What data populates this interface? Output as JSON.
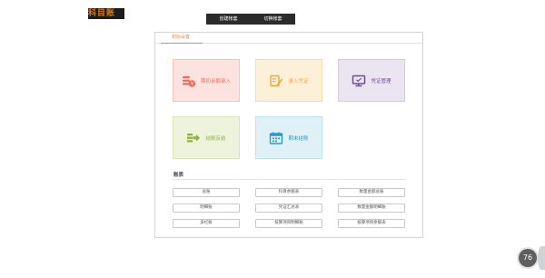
{
  "app": {
    "logo_text": "科目账"
  },
  "toolbar": {
    "buttons": [
      "创建帐套",
      "切换帐套"
    ]
  },
  "panel": {
    "tab_label": "初始设置",
    "tiles": [
      {
        "label": "期初余额录入",
        "icon": "coin-stack-icon",
        "bg": "#fde3df",
        "border": "#f5c4bd",
        "text": "#ea6c5a",
        "icon_color": "#ea6c5a"
      },
      {
        "label": "录入凭证",
        "icon": "edit-document-icon",
        "bg": "#fdf0d9",
        "border": "#f6dcae",
        "text": "#f0a73c",
        "icon_color": "#f0a73c"
      },
      {
        "label": "凭证管理",
        "icon": "monitor-icon",
        "bg": "#ebe4f1",
        "border": "#d6cae3",
        "text": "#6f4d93",
        "icon_color": "#6f4d93"
      },
      {
        "label": "结账反结",
        "icon": "transfer-icon",
        "bg": "#eef3dc",
        "border": "#dbe6b8",
        "text": "#8db43d",
        "icon_color": "#8db43d"
      },
      {
        "label": "期末结账",
        "icon": "calendar-icon",
        "bg": "#dff1f7",
        "border": "#bfe2ee",
        "text": "#2b9cc6",
        "icon_color": "#2b9cc6"
      }
    ],
    "reports_title": "账表",
    "reports": [
      "总账",
      "科目余额表",
      "数量金额总账",
      "明细账",
      "凭证汇总表",
      "数量金额明细账",
      "多栏账",
      "核算项目明细账",
      "核算项目余额表"
    ]
  },
  "badge": {
    "value": "76"
  }
}
